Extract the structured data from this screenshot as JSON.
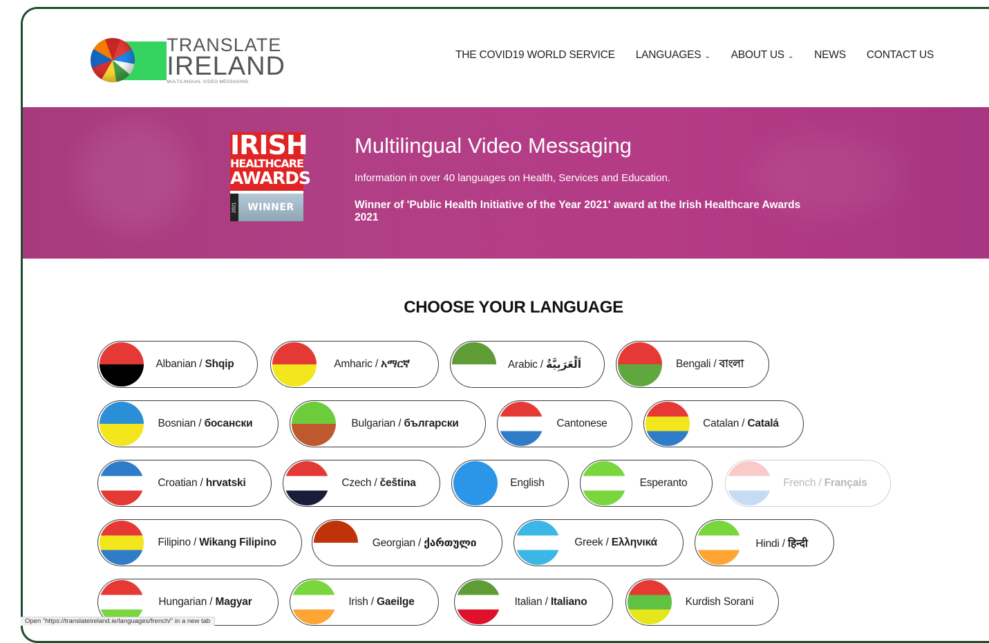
{
  "logo": {
    "line1": "TRANSLATE",
    "line2": "IRELAND",
    "line3": "MULTILINGUAL VIDEO MESSAGING"
  },
  "nav": {
    "items": [
      {
        "label": "THE COVID19 WORLD SERVICE",
        "dropdown": false
      },
      {
        "label": "LANGUAGES",
        "dropdown": true
      },
      {
        "label": "ABOUT US",
        "dropdown": true
      },
      {
        "label": "NEWS",
        "dropdown": false
      },
      {
        "label": "CONTACT US",
        "dropdown": false
      }
    ],
    "chevron": "⌄"
  },
  "hero": {
    "badge": {
      "line1": "IRISH",
      "line2": "HEALTHCARE",
      "line3": "AWARDS",
      "year": "2021",
      "winner": "WINNER"
    },
    "title": "Multilingual Video Messaging",
    "subtitle": "Information in over 40 languages on Health, Services and Education.",
    "award": "Winner of 'Public Health Initiative of the Year 2021' award at the Irish Healthcare Awards 2021",
    "color": "#b13f85"
  },
  "languages": {
    "heading": "CHOOSE YOUR LANGUAGE",
    "items": [
      {
        "name": "Albanian",
        "native": "Shqip",
        "colors": [
          "#e53935",
          "#000000"
        ]
      },
      {
        "name": "Amharic",
        "native": "አማርኛ",
        "colors": [
          "#e53935",
          "#f4e61c"
        ]
      },
      {
        "name": "Arabic",
        "native": "اَلْعَرَبِيَّةُ",
        "colors": [
          "#5f9c35",
          "#ffffff"
        ]
      },
      {
        "name": "Bengali",
        "native": "বাংলা",
        "colors": [
          "#e53935",
          "#5fa83f"
        ]
      },
      {
        "name": "Bosnian",
        "native": "босански",
        "colors": [
          "#2b8fd8",
          "#f4e61c"
        ]
      },
      {
        "name": "Bulgarian",
        "native": "български",
        "colors": [
          "#6ccc3c",
          "#c0582e"
        ]
      },
      {
        "name": "Cantonese",
        "native": "",
        "colors": [
          "#e53935",
          "#ffffff",
          "#2f7cc8"
        ]
      },
      {
        "name": "Catalan",
        "native": "Catalá",
        "colors": [
          "#e53935",
          "#f4e61c",
          "#2f7cc8"
        ]
      },
      {
        "name": "Croatian",
        "native": "hrvatski",
        "colors": [
          "#2f7cc8",
          "#ffffff",
          "#e53935"
        ]
      },
      {
        "name": "Czech",
        "native": "čeština",
        "colors": [
          "#e53935",
          "#ffffff",
          "#1b1b3a"
        ]
      },
      {
        "name": "English",
        "native": "",
        "colors": [
          "#2b96e8"
        ]
      },
      {
        "name": "Esperanto",
        "native": "",
        "colors": [
          "#79d63d",
          "#ffffff",
          "#79d63d"
        ]
      },
      {
        "name": "French",
        "native": "Français",
        "colors": [
          "#f08a8a",
          "#ffffff",
          "#7fb0e8"
        ],
        "faded": true
      },
      {
        "name": "Filipino",
        "native": "Wikang Filipino",
        "colors": [
          "#e53935",
          "#f4e61c",
          "#2f7cc8"
        ]
      },
      {
        "name": "Georgian",
        "native": "ქართული",
        "colors": [
          "#c0330a",
          "#ffffff"
        ]
      },
      {
        "name": "Greek",
        "native": "Ελληνικά",
        "colors": [
          "#3ab7e6",
          "#ffffff",
          "#3ab7e6"
        ]
      },
      {
        "name": "Hindi",
        "native": "हिन्दी",
        "colors": [
          "#79d63d",
          "#ffffff",
          "#ffa533"
        ]
      },
      {
        "name": "Hungarian",
        "native": "Magyar",
        "colors": [
          "#e53935",
          "#ffffff",
          "#79d63d"
        ]
      },
      {
        "name": "Irish",
        "native": "Gaeilge",
        "colors": [
          "#79d63d",
          "#ffffff",
          "#ffa533"
        ]
      },
      {
        "name": "Italian",
        "native": "Italiano",
        "colors": [
          "#5f9c35",
          "#ffffff",
          "#e0102a"
        ]
      },
      {
        "name": "Kurdish Sorani",
        "native": "",
        "colors": [
          "#e53935",
          "#5fc242",
          "#e6e61c"
        ]
      }
    ]
  },
  "status_bar": "Open \"https://translateireland.ie/languages/french/\" in a new tab"
}
